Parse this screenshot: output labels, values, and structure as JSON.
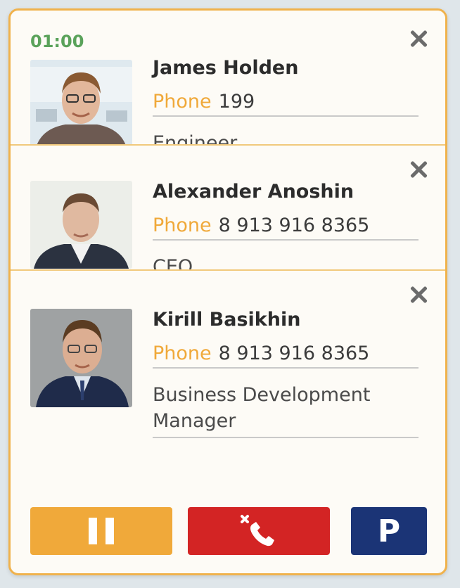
{
  "timer": "01:00",
  "contacts": [
    {
      "name": "James Holden",
      "phone_label": "Phone",
      "phone": "199",
      "role": "Engineer"
    },
    {
      "name": "Alexander Anoshin",
      "phone_label": "Phone",
      "phone": "8 913 916 8365",
      "role": "CEO"
    },
    {
      "name": "Kirill Basikhin",
      "phone_label": "Phone",
      "phone": "8 913 916 8365",
      "role": "Business Development Manager"
    }
  ],
  "buttons": {
    "park_label": "P"
  },
  "icons": {
    "close": "close-icon",
    "hold": "pause-icon",
    "hangup": "hangup-phone-icon",
    "park": "park-icon"
  },
  "colors": {
    "accent": "#f0b24c",
    "timer": "#5aa25a",
    "phone_label": "#f0a93a",
    "hold": "#f0a93a",
    "hangup": "#d32424",
    "park": "#1b3476"
  }
}
